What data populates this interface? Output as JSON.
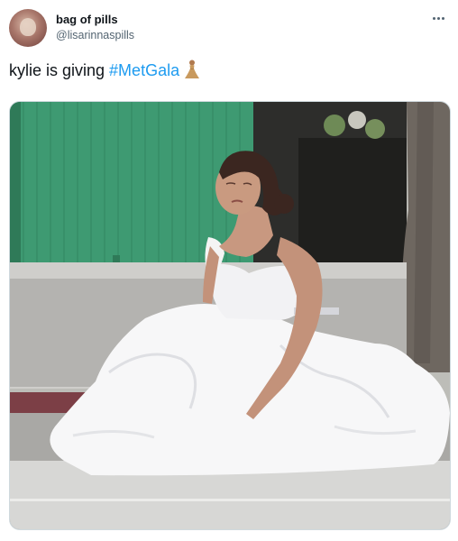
{
  "tweet": {
    "author": {
      "display_name": "bag of pills",
      "handle": "@lisarinnaspills",
      "avatar_icon": "avatar-image"
    },
    "text": {
      "prefix": "kylie is giving ",
      "hashtag": "#MetGala",
      "emoji_icon": "person-in-gown-emoji"
    },
    "more_icon": "more-options-icon",
    "media": {
      "kind": "photo",
      "subject": "woman in white wedding dress sitting on street"
    }
  },
  "colors": {
    "text": "#0f1419",
    "secondary": "#536471",
    "link": "#1d9bf0",
    "border": "#cfd9de"
  }
}
